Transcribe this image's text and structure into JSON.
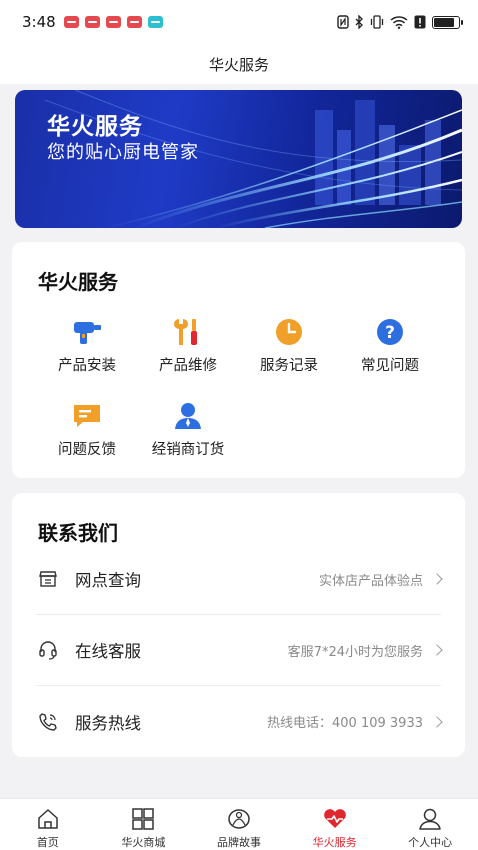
{
  "status_bar": {
    "time": "3:48"
  },
  "nav": {
    "title": "华火服务"
  },
  "banner": {
    "title": "华火服务",
    "subtitle": "您的贴心厨电管家"
  },
  "services": {
    "title": "华火服务",
    "items": [
      {
        "label": "产品安装",
        "icon": "drill-icon"
      },
      {
        "label": "产品维修",
        "icon": "tools-icon"
      },
      {
        "label": "服务记录",
        "icon": "clock-icon"
      },
      {
        "label": "常见问题",
        "icon": "question-icon"
      },
      {
        "label": "问题反馈",
        "icon": "feedback-icon"
      },
      {
        "label": "经销商订货",
        "icon": "dealer-icon"
      }
    ]
  },
  "contact": {
    "title": "联系我们",
    "rows": [
      {
        "label": "网点查询",
        "desc": "实体店产品体验点",
        "icon": "store-icon"
      },
      {
        "label": "在线客服",
        "desc": "客服7*24小时为您服务",
        "icon": "headset-icon"
      },
      {
        "label": "服务热线",
        "desc": "热线电话：400 109 3933",
        "icon": "phone-icon"
      }
    ]
  },
  "tabs": [
    {
      "label": "首页",
      "icon": "home-icon"
    },
    {
      "label": "华火商城",
      "icon": "grid-icon"
    },
    {
      "label": "品牌故事",
      "icon": "brand-icon"
    },
    {
      "label": "华火服务",
      "icon": "service-heart-icon",
      "active": true
    },
    {
      "label": "个人中心",
      "icon": "profile-icon"
    }
  ],
  "colors": {
    "accent": "#e0262f",
    "banner_bg": "#1f3bc6",
    "icon_blue": "#2d6fe0",
    "icon_orange": "#f0a028"
  }
}
